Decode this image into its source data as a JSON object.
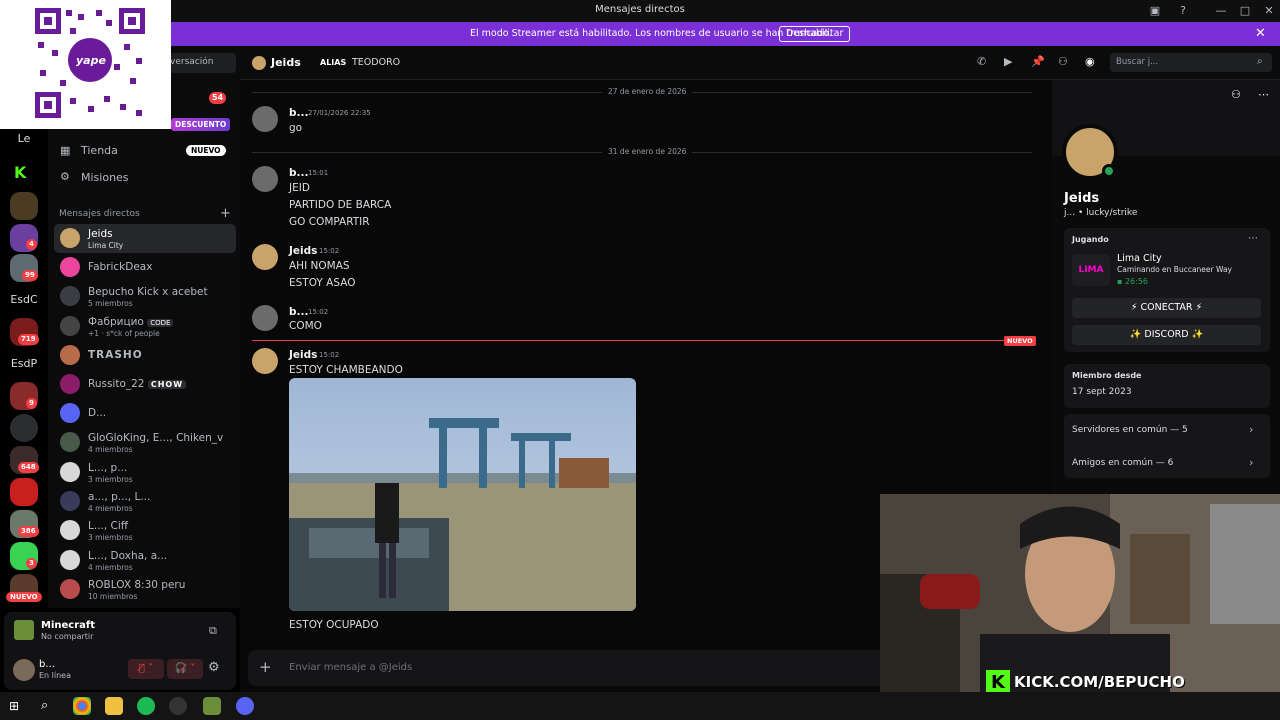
{
  "window": {
    "title": "Mensajes directos"
  },
  "banner": {
    "message": "El modo Streamer está habilitado. Los nombres de usuario se han truncado.",
    "button": "Deshabilitar"
  },
  "sidebar": {
    "search_fragment": "versación",
    "badge_count": "54",
    "discount_badge": "DESCUENTO",
    "shop": "Tienda",
    "shop_badge": "NUEVO",
    "quests": "Misiones",
    "dm_header": "Mensajes directos",
    "dms": [
      {
        "name": "Jeids",
        "sub": "Lima City"
      },
      {
        "name": "FabrickDeax",
        "sub": ""
      },
      {
        "name": "Bepucho Kick x acebet",
        "sub": "5 miembros"
      },
      {
        "name": "Фабрицио",
        "tag": "CODE",
        "sub": "+1 · s*ck of people"
      },
      {
        "name": "TRASHO",
        "sub": ""
      },
      {
        "name": "Russito_22",
        "tag": "CHOW",
        "sub": ""
      },
      {
        "name": "D...",
        "sub": ""
      },
      {
        "name": "GloGloKing, E..., Chiken_v",
        "sub": "4 miembros"
      },
      {
        "name": "L..., p...",
        "sub": "3 miembros"
      },
      {
        "name": "a..., p..., L...",
        "sub": "4 miembros"
      },
      {
        "name": "L..., Ciff",
        "sub": "3 miembros"
      },
      {
        "name": "L..., Doxha, a...",
        "sub": "4 miembros"
      },
      {
        "name": "ROBLOX 8:30 peru",
        "sub": "10 miembros"
      }
    ]
  },
  "rail": {
    "le_label": "Le",
    "esdc_label": "EsdC",
    "esdp_label": "EsdP",
    "new_label": "NUEVO",
    "badges": [
      "4",
      "99",
      "719",
      "9",
      "648",
      "386",
      "3"
    ]
  },
  "activity": {
    "game": "Minecraft",
    "status": "No compartir"
  },
  "user": {
    "name": "b...",
    "status": "En línea"
  },
  "chat_header": {
    "name": "Jeids",
    "alias_label": "ALIAS",
    "alias": "TEODORO",
    "search_placeholder": "Buscar j..."
  },
  "messages": {
    "date1": "27 de enero de 2026",
    "date2": "31 de enero de 2026",
    "new_label": "NUEVO",
    "groups": [
      {
        "author": "b...",
        "time": "27/01/2026 22:35",
        "lines": [
          "go"
        ]
      },
      {
        "author": "b...",
        "time": "15:01",
        "lines": [
          "JEID",
          "PARTIDO DE BARCA",
          "GO COMPARTIR"
        ]
      },
      {
        "author": "Jeids",
        "time": "15:02",
        "lines": [
          "AHI NOMAS",
          "ESTOY ASAO"
        ]
      },
      {
        "author": "b...",
        "time": "15:02",
        "lines": [
          "COMO"
        ]
      },
      {
        "author": "Jeids",
        "time": "15:02",
        "lines": [
          "ESTOY CHAMBEANDO"
        ]
      }
    ],
    "after_image": "ESTOY OCUPADO",
    "composer_placeholder": "Enviar mensaje a @Jeids"
  },
  "profile": {
    "name": "Jeids",
    "handle": "j... • lucky/strike",
    "playing_label": "Jugando",
    "game": "Lima City",
    "game_detail": "Caminando en Buccaneer Way",
    "elapsed": "26:56",
    "connect_btn": "⚡ CONECTAR ⚡",
    "discord_btn": "✨ DISCORD ✨",
    "member_since_label": "Miembro desde",
    "member_since": "17 sept 2023",
    "servers": "Servidores en común — 5",
    "friends": "Amigos en común — 6"
  },
  "overlay": {
    "kick_url": "KICK.COM/BEPUCHO",
    "qr_label": "yape"
  },
  "colors": {
    "accent": "#7b2fd6",
    "online": "#23a55a",
    "mention": "#f23f43",
    "kick": "#53fc18"
  }
}
